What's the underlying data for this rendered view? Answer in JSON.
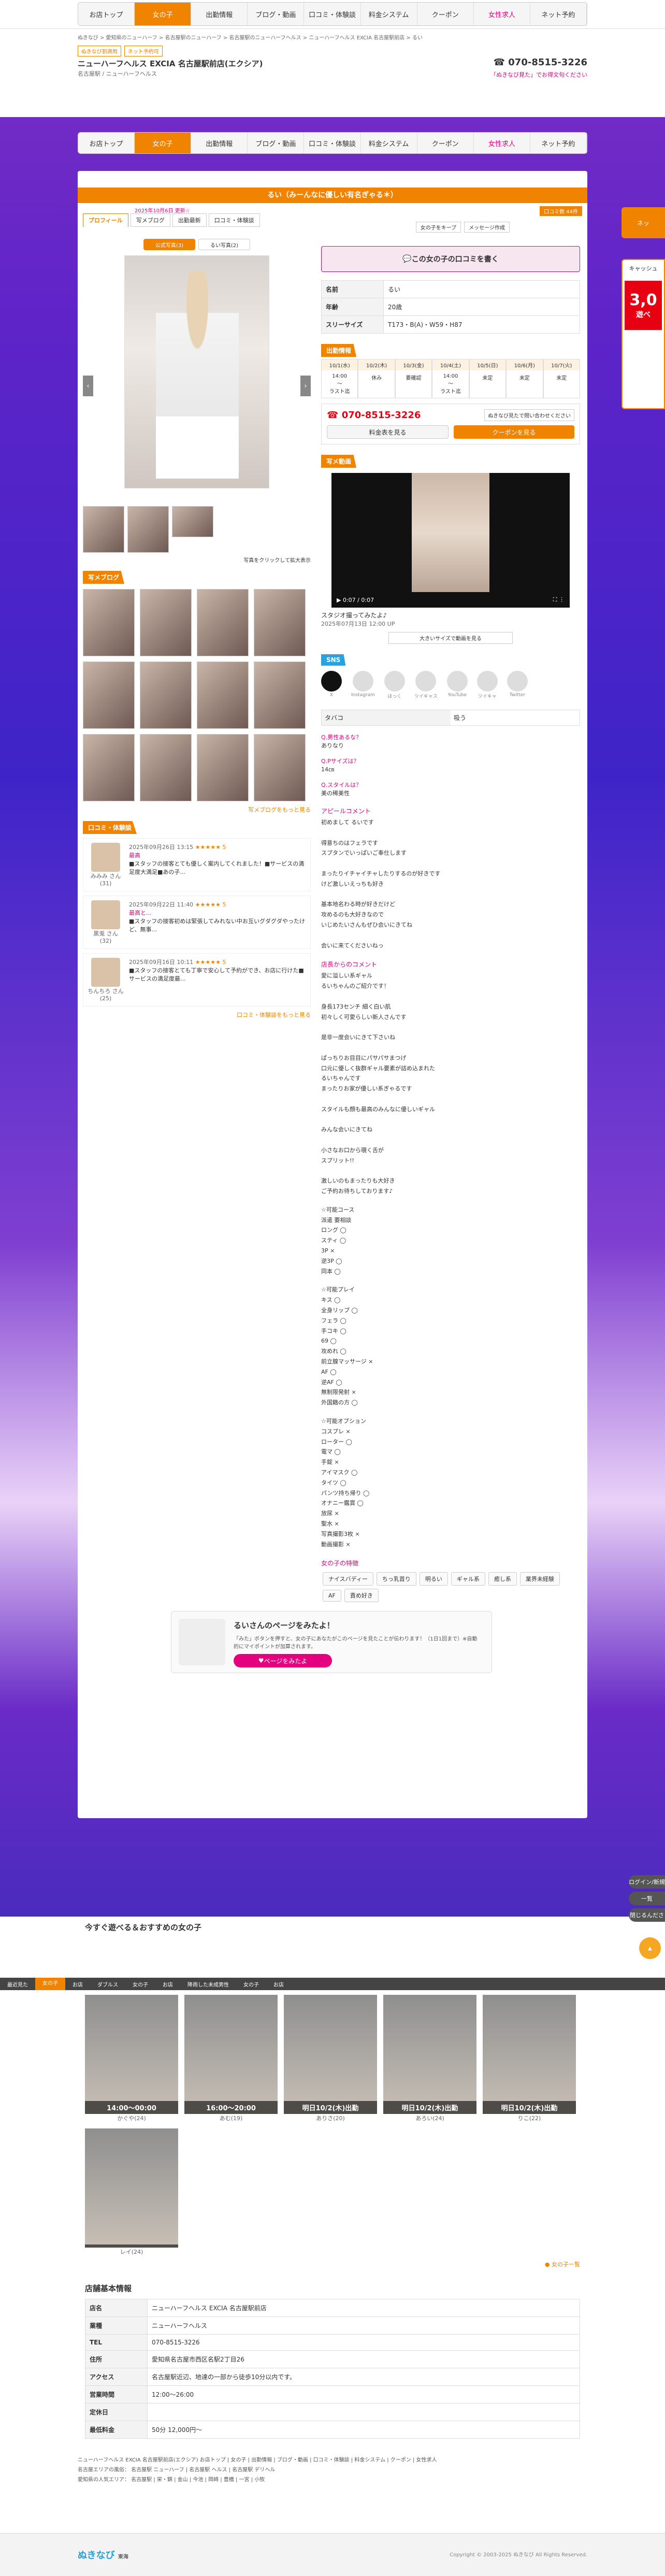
{
  "nav": {
    "items": [
      "お店トップ",
      "女の子",
      "出勤情報",
      "ブログ・動画",
      "口コミ・体験談",
      "料金システム",
      "クーポン",
      "女性求人",
      "ネット予約"
    ],
    "active": 1
  },
  "breadcrumb": "ぬきなび > 愛知県のニューハーフ > 名古屋駅のニューハーフ > 名古屋駅のニューハーフヘルス > ニューハーフヘルス EXCIA 名古屋駅前店 > るい",
  "shop": {
    "badges": [
      "ぬきなび割適用",
      "ネット予約可"
    ],
    "name": "ニューハーフヘルス EXCIA 名古屋駅前店(エクシア)",
    "area": "名古屋駅 / ニューハーフヘルス",
    "tel": "070-8515-3226",
    "tel_note": "「ぬきなび見た」でお得文句ください"
  },
  "girl": {
    "title": "るい（みーんなに優しい有名ぎゃる＊）",
    "update": "2025年10月6日 更新☆",
    "review_count": "口コミ数 44件",
    "tabs": [
      "プロフィール",
      "写メブログ",
      "出勤最新",
      "口コミ・体験談"
    ],
    "photo_tabs": [
      "公式写真(3)",
      "るい写真(2)"
    ],
    "photo_note": "写真をクリックして拡大表示",
    "review_button": "この女の子の口コミを書く",
    "keep": "女の子をキープ",
    "message": "メッセージ作成",
    "profile": [
      {
        "k": "名前",
        "v": "るい"
      },
      {
        "k": "年齢",
        "v": "20歳"
      },
      {
        "k": "スリーサイズ",
        "v": "T173・B(A)・W59・H87"
      }
    ],
    "schedule_title": "出勤情報",
    "schedule": [
      {
        "d": "10/1(水)",
        "t": "14:00\n〜\nラスト迄"
      },
      {
        "d": "10/2(木)",
        "t": "休み"
      },
      {
        "d": "10/3(金)",
        "t": "要確認"
      },
      {
        "d": "10/4(土)",
        "t": "14:00\n〜\nラスト迄"
      },
      {
        "d": "10/5(日)",
        "t": "未定"
      },
      {
        "d": "10/6(月)",
        "t": "未定"
      },
      {
        "d": "10/7(火)",
        "t": "未定"
      }
    ],
    "call_tel": "070-8515-3226",
    "call_note": "ぬきなび見たで問い合わせください",
    "btn_price": "料金表を見る",
    "btn_coupon": "クーポンを見る",
    "video_title": "写メ動画",
    "video_caption": "スタジオ撮ってみたよ♪",
    "video_time": "0:07 / 0:07",
    "video_date": "2025年07月13日 12:00 UP",
    "video_btn": "大きいサイズで動画を見る",
    "sns_title": "SNS",
    "sns": [
      "X",
      "Instagram",
      "ほっく",
      "ツイキャス",
      "YouTube",
      "ツイキャ",
      "Twitter"
    ],
    "qa_tab": [
      "タバコ",
      "吸う"
    ],
    "qa": [
      {
        "q": "Q.男性あるな？",
        "a": "ありなり"
      },
      {
        "q": "Q.Pサイズは？",
        "a": "14㎝"
      },
      {
        "q": "Q.スタイルは？",
        "a": "美の稀美性"
      }
    ],
    "appeal_title": "アピールコメント",
    "appeal": "初めまして るいです\n\n得意ちのはフェラです\nスプタンでいっぱいご奉仕します\n\nまったりイチャイチャしたりするのが好きです\nけど激しいえっちも好き\n\n基本地名わる時が好きだけど\n攻めるのも大好きなので\nいじめたいさんもぜひ会いにきてね\n\n会いに来てくださいねっ",
    "staff_title": "店長からのコメント",
    "staff": "愛に溢しい系ギャル\nるいちゃんのご紹介です！\n\n身長173センチ 細く白い肌\n初々しく可愛らしい新人さんです\n\n是非一度会いにきて下さいね\n\nぱっちりお目目にパサパサまつげ\n口元に優しく抜群ギャル要素が詰め込まれた\nるいちゃんです\nまったりお家が優しい系ぎゃるです\n\nスタイルも顔も最高のみんなに優しいギャル\n\nみんな会いにきてね\n\n小さなお口から覗く舌が\nスプリット!!\n\n激しいのもまったりも大好き\nご予約お待ちしております♪",
    "course": "☆可能コース\n派遣 要相談\nロング ◯\nスティ ◯\n3P ×\n逆3P ◯\n同本 ◯",
    "play": "☆可能プレイ\nキス ◯\n全身リップ ◯\nフェラ ◯\n手コキ ◯\n69 ◯\n攻めれ ◯\n前立腺マッサージ ×\nAF ◯\n逆AF ◯\n無制限発射 ×\n外国籍の方 ◯",
    "option": "☆可能オプション\nコスプレ ×\nローター ◯\n電マ ◯\n手錠 ×\nアイマスク ◯\nタイツ ◯\nパンツ持ち帰り ◯\nオナニー鑑賞 ◯\n放尿 ×\n聖水 ×\n写真撮影3枚 ×\n動画撮影 ×",
    "features_title": "女の子の特徴",
    "features": [
      "ナイスバディー",
      "ちっ乳首り",
      "明るい",
      "ギャル系",
      "癒し系",
      "業界未経験",
      "AF",
      "責め好き"
    ],
    "photo_blog_title": "写メブログ",
    "photo_blog_more": "写メブログをもっと見る",
    "reviews_title": "口コミ・体験談",
    "reviews_more": "口コミ・体験談をもっと見る",
    "reviews": [
      {
        "user": "みみみ さん(31)",
        "date": "2025年09月26日 13:15",
        "score": "★★★★★ 5",
        "t": "最高",
        "b": "■スタッフの接客とても優しく案内してくれました！■サービスの満足度大満足■あの子..."
      },
      {
        "user": "黒兎 さん(32)",
        "date": "2025年09月22日 11:40",
        "score": "★★★★★ 5",
        "t": "最高と...",
        "b": "■スタッフの接客初めは緊張してみれない中お互いグダグダやったけど、無事..."
      },
      {
        "user": "ちんちろ さん(25)",
        "date": "2025年09月16日 10:11",
        "score": "★★★★★ 5",
        "t": "",
        "b": "■スタッフの接客とても丁寧で安心して予約ができ、お店に行けた■サービスの満足度最..."
      }
    ]
  },
  "promo": {
    "title": "るいさんのページをみたよ！",
    "text": "「みた」ボタンを押すと、女の子にあなたがこのページを見たことが伝わります！（1日1回まで）※自動的にマイポイントが加算されます。",
    "button": "ページをみたよ"
  },
  "recommend": {
    "title": "今すぐ遊べる＆おすすめの女の子",
    "items": [
      {
        "time": "14:00〜00:00",
        "name": "かぐや(24)"
      },
      {
        "time": "16:00〜20:00",
        "name": "あむ(19)"
      },
      {
        "time": "明日10/2(木)出勤",
        "name": "ありさ(20)"
      },
      {
        "time": "明日10/2(木)出勤",
        "name": "あろい(24)"
      },
      {
        "time": "明日10/2(木)出勤",
        "name": "りこ(22)"
      },
      {
        "time": "",
        "name": "レイ(24)"
      }
    ],
    "more": "女の子一覧"
  },
  "shopinfo": {
    "title": "店舗基本情報",
    "rows": [
      {
        "k": "店名",
        "v": "ニューハーフヘルス EXCIA 名古屋駅前店"
      },
      {
        "k": "業種",
        "v": "ニューハーフヘルス"
      },
      {
        "k": "TEL",
        "v": "070-8515-3226"
      },
      {
        "k": "住所",
        "v": "愛知県名古屋市西区名駅2丁目26"
      },
      {
        "k": "アクセス",
        "v": "名古屋駅近辺、地達の一部から徒歩10分以内です。"
      },
      {
        "k": "営業時間",
        "v": "12:00〜26:00"
      },
      {
        "k": "定休日",
        "v": ""
      },
      {
        "k": "最低料金",
        "v": "50分 12,000円〜"
      }
    ]
  },
  "bottom_tabs": [
    "最近見た",
    "女の子",
    "お店",
    "ダブルス",
    "女の子",
    "お店",
    "降雨した未成男性",
    "女の子",
    "お店"
  ],
  "side": [
    "ログイン/新規",
    "一覧",
    "閉じるんださ"
  ],
  "footer": {
    "links": "ニューハーフヘルス EXCIA 名古屋駅前店(エクシア) お店トップ | 女の子 | 出勤情報 | ブログ・動画 | 口コミ・体験談 | 料金システム | クーポン | 女性求人",
    "area1": "名古屋エリアの風俗： 名古屋駅 ニューハーフ | 名古屋駅 ヘルス | 名古屋駅 デリヘル",
    "area2": "愛知県の人気エリア： 名古屋駅 | 栄・錦 | 金山 | 今池 | 岡崎 | 豊橋 | 一宮 | 小牧",
    "copyright": "Copyright © 2003-2025 ぬきなび All Rights Reserved.",
    "logo": "ぬきなび",
    "logo_area": "東海"
  },
  "right_ad": {
    "label": "キャッシュ",
    "big": "3,0",
    "sub": "遊べ"
  }
}
